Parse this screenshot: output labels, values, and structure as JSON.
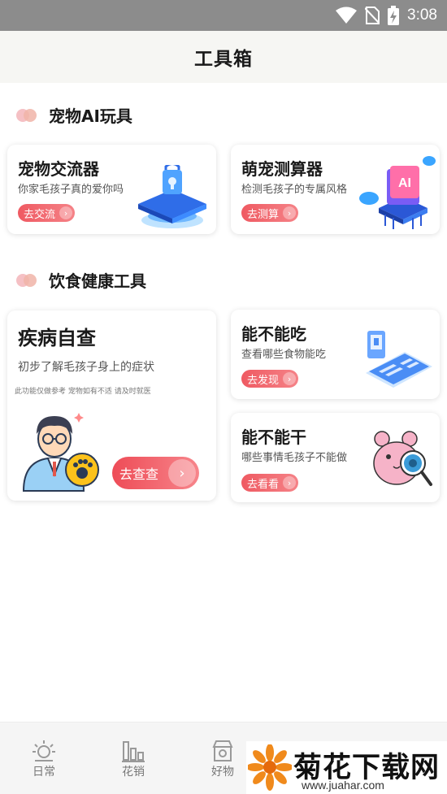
{
  "status_bar": {
    "time": "3:08",
    "icons": [
      "wifi-icon",
      "no-sim-icon",
      "battery-charging-icon"
    ]
  },
  "header": {
    "title": "工具箱"
  },
  "section_pet_ai": {
    "title": "宠物AI玩具"
  },
  "translator": {
    "title": "宠物交流器",
    "subtitle": "你家毛孩子真的爱你吗",
    "button": "去交流"
  },
  "calculator": {
    "title": "萌宠测算器",
    "subtitle": "检测毛孩子的专属风格",
    "button": "去测算",
    "badge": "AI"
  },
  "section_health": {
    "title": "饮食健康工具"
  },
  "disease": {
    "title": "疾病自查",
    "subtitle": "初步了解毛孩子身上的症状",
    "note": "此功能仅做参考 宠物如有不适 请及时就医",
    "button": "去查查"
  },
  "can_eat": {
    "title": "能不能吃",
    "subtitle": "查看哪些食物能吃",
    "button": "去发现"
  },
  "can_do": {
    "title": "能不能干",
    "subtitle": "哪些事情毛孩子不能做",
    "button": "去看看"
  },
  "tabbar": {
    "items": [
      {
        "label": "日常",
        "icon": "sun-icon"
      },
      {
        "label": "花销",
        "icon": "bar-chart-icon"
      },
      {
        "label": "好物",
        "icon": "shop-icon"
      }
    ]
  },
  "watermark": {
    "title": "菊花下载网",
    "url": "www.juahar.com"
  },
  "colors": {
    "accent": "#ef5a62",
    "header_bg": "#f6f6f3",
    "status_bg": "#8c8c8c"
  }
}
